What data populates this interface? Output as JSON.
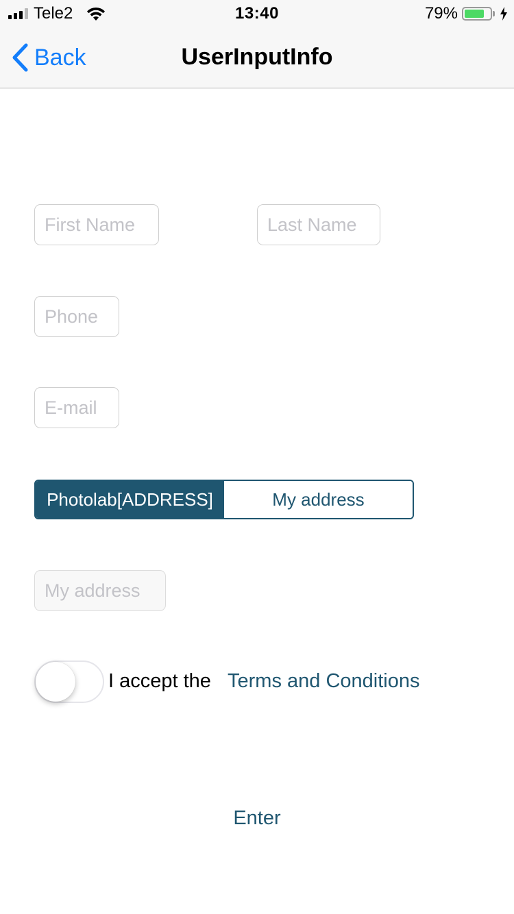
{
  "status_bar": {
    "carrier": "Tele2",
    "time": "13:40",
    "battery_percent": "79%",
    "battery_level": 0.79,
    "signal_bars": 4,
    "signal_active": 3
  },
  "navbar": {
    "back_label": "Back",
    "title": "UserInputInfo"
  },
  "form": {
    "first_name": {
      "value": "",
      "placeholder": "First Name"
    },
    "last_name": {
      "value": "",
      "placeholder": "Last Name"
    },
    "phone": {
      "value": "",
      "placeholder": "Phone"
    },
    "email": {
      "value": "",
      "placeholder": "E-mail"
    },
    "address_segment": {
      "options": [
        "Photolab[ADDRESS]",
        "My address"
      ],
      "selected": "Photolab[ADDRESS]"
    },
    "address": {
      "value": "",
      "placeholder": "My address",
      "enabled": false
    },
    "terms_toggle": {
      "on": false
    },
    "accept_text": "I accept the",
    "terms_link": "Terms and Conditions",
    "submit_label": "Enter"
  },
  "colors": {
    "accent": "#1f5670",
    "ios_blue": "#147efb",
    "battery_green": "#4cd964"
  }
}
